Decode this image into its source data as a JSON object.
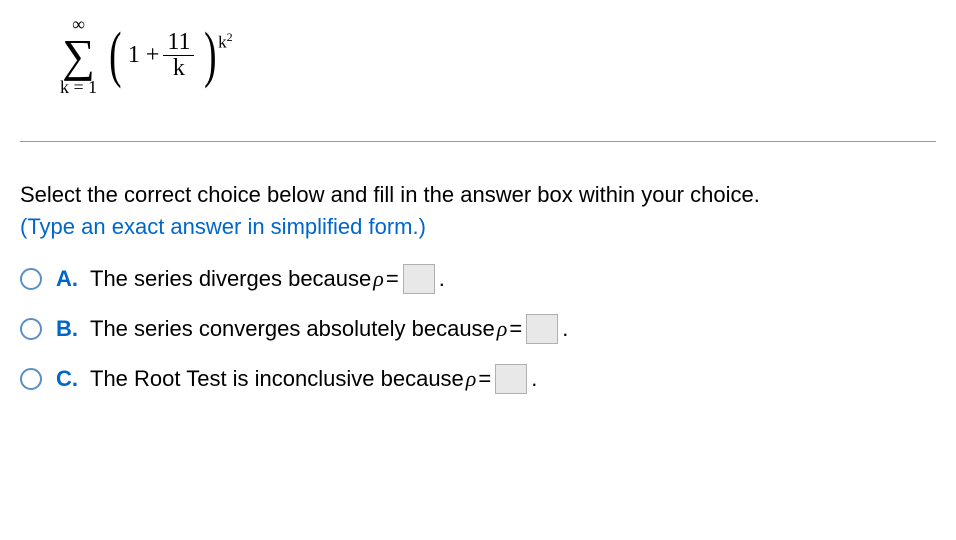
{
  "formula": {
    "upper": "∞",
    "lower": "k = 1",
    "one_plus": "1 +",
    "frac_num": "11",
    "frac_den": "k",
    "exponent_base": "k",
    "exponent_sup": "2"
  },
  "instructions": "Select the correct choice below and fill in the answer box within your choice.",
  "hint": "(Type an exact answer in simplified form.)",
  "choices": {
    "a": {
      "label": "A.",
      "prefix": "The series diverges because ",
      "rho": "ρ",
      "equals": " = ",
      "suffix": "."
    },
    "b": {
      "label": "B.",
      "prefix": "The series converges absolutely because ",
      "rho": "ρ",
      "equals": " = ",
      "suffix": "."
    },
    "c": {
      "label": "C.",
      "prefix": "The Root Test is inconclusive because ",
      "rho": "ρ",
      "equals": " = ",
      "suffix": "."
    }
  }
}
